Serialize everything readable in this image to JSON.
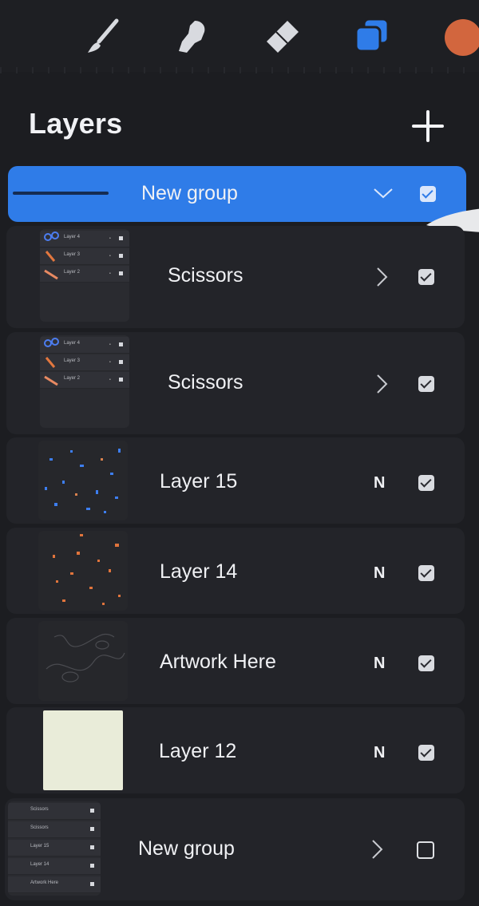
{
  "panel": {
    "title": "Layers"
  },
  "colors": {
    "accent": "#2f7ce8",
    "current_color": "#d2663e",
    "background": "#1c1d21",
    "row": "#232429"
  },
  "toolbar": {
    "tools": [
      "brush-icon",
      "smudge-icon",
      "eraser-icon",
      "layers-icon"
    ]
  },
  "layers": [
    {
      "name": "New group",
      "type": "group",
      "expanded": true,
      "visible": true,
      "selected": true
    },
    {
      "name": "Scissors",
      "type": "group",
      "expanded": false,
      "visible": true,
      "thumbnail_layers": [
        "Layer 4",
        "Layer 3",
        "Layer 2"
      ]
    },
    {
      "name": "Scissors",
      "type": "group",
      "expanded": false,
      "visible": true,
      "thumbnail_layers": [
        "Layer 4",
        "Layer 3",
        "Layer 2"
      ]
    },
    {
      "name": "Layer 15",
      "type": "layer",
      "blend": "N",
      "visible": true
    },
    {
      "name": "Layer 14",
      "type": "layer",
      "blend": "N",
      "visible": true
    },
    {
      "name": "Artwork Here",
      "type": "layer",
      "blend": "N",
      "visible": true
    },
    {
      "name": "Layer 12",
      "type": "layer",
      "blend": "N",
      "visible": true
    },
    {
      "name": "New group",
      "type": "group",
      "expanded": false,
      "visible": false,
      "thumbnail_layers": [
        "Scissors",
        "Scissors",
        "Layer 15",
        "Layer 14",
        "Artwork Here"
      ]
    }
  ]
}
